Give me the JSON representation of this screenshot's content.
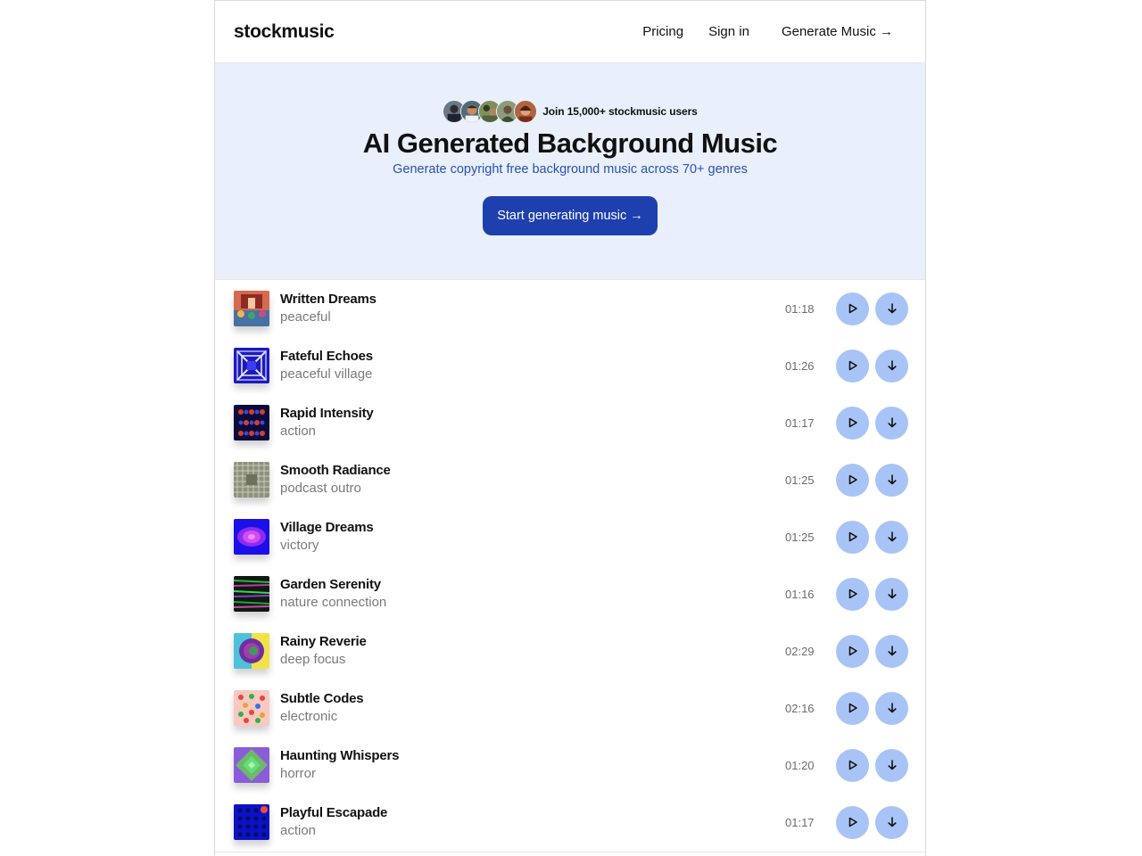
{
  "header": {
    "logo": "stockmusic",
    "nav": {
      "pricing": "Pricing",
      "signin": "Sign in",
      "generate": "Generate Music →"
    }
  },
  "hero": {
    "social_proof": "Join 15,000+ stockmusic users",
    "title": "AI Generated Background Music",
    "subtitle": "Generate copyright free background music across 70+ genres",
    "cta": "Start generating music →"
  },
  "tracks": [
    {
      "title": "Written Dreams",
      "genre": "peaceful",
      "duration": "01:18"
    },
    {
      "title": "Fateful Echoes",
      "genre": "peaceful village",
      "duration": "01:26"
    },
    {
      "title": "Rapid Intensity",
      "genre": "action",
      "duration": "01:17"
    },
    {
      "title": "Smooth Radiance",
      "genre": "podcast outro",
      "duration": "01:25"
    },
    {
      "title": "Village Dreams",
      "genre": "victory",
      "duration": "01:25"
    },
    {
      "title": "Garden Serenity",
      "genre": "nature connection",
      "duration": "01:16"
    },
    {
      "title": "Rainy Reverie",
      "genre": "deep focus",
      "duration": "02:29"
    },
    {
      "title": "Subtle Codes",
      "genre": "electronic",
      "duration": "02:16"
    },
    {
      "title": "Haunting Whispers",
      "genre": "horror",
      "duration": "01:20"
    },
    {
      "title": "Playful Escapade",
      "genre": "action",
      "duration": "01:17"
    }
  ],
  "icons": {
    "play": "play-icon",
    "download": "download-arrow-icon"
  },
  "colors": {
    "hero_bg": "#e9f0fb",
    "accent": "#1e3fae",
    "subtitle": "#2b4fb8",
    "button_bg": "#a8c4f6"
  }
}
